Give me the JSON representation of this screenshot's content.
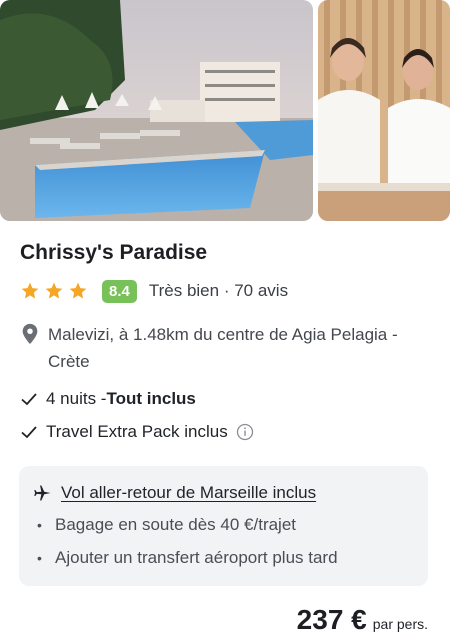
{
  "hotel": {
    "name": "Chrissy's Paradise",
    "stars": 3,
    "score": "8.4",
    "score_label": "Très bien · 70 avis",
    "location": "Malevizi, à 1.48km du centre de Agia Pelagia - Crète"
  },
  "features": {
    "nights": "4 nuits - ",
    "board": "Tout inclus",
    "extra_pack": "Travel Extra Pack inclus"
  },
  "flight": {
    "label": "Vol aller-retour de Marseille inclus",
    "bullets": [
      "Bagage en soute dès 40 €/trajet",
      "Ajouter un transfert aéroport plus tard"
    ]
  },
  "price": {
    "amount": "237 €",
    "unit": "par pers."
  },
  "icons": {
    "star": "star-icon",
    "location": "location-pin-icon",
    "check": "checkmark-icon",
    "info": "info-icon",
    "plane": "airplane-icon"
  },
  "colors": {
    "star": "#f5a623",
    "score_badge": "#78c159",
    "panel_bg": "#f2f3f5"
  }
}
